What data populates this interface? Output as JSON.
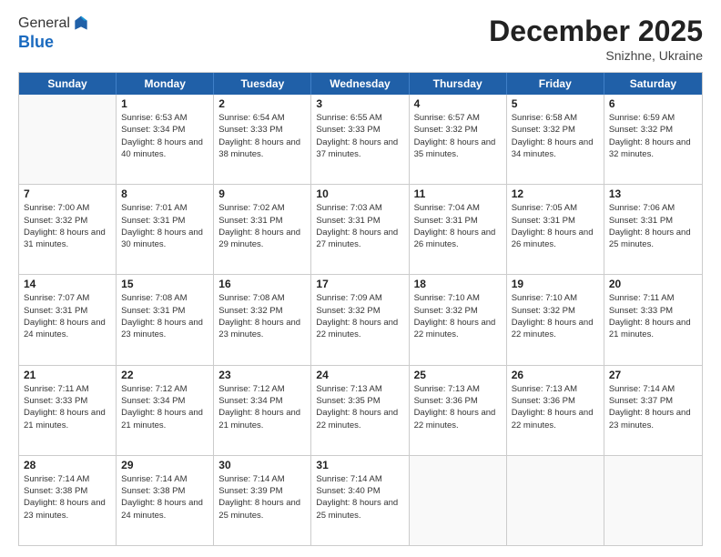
{
  "header": {
    "logo_general": "General",
    "logo_blue": "Blue",
    "month_title": "December 2025",
    "location": "Snizhne, Ukraine"
  },
  "days_of_week": [
    "Sunday",
    "Monday",
    "Tuesday",
    "Wednesday",
    "Thursday",
    "Friday",
    "Saturday"
  ],
  "weeks": [
    [
      {
        "day": "",
        "empty": true
      },
      {
        "day": "1",
        "sunrise": "6:53 AM",
        "sunset": "3:34 PM",
        "daylight": "8 hours and 40 minutes."
      },
      {
        "day": "2",
        "sunrise": "6:54 AM",
        "sunset": "3:33 PM",
        "daylight": "8 hours and 38 minutes."
      },
      {
        "day": "3",
        "sunrise": "6:55 AM",
        "sunset": "3:33 PM",
        "daylight": "8 hours and 37 minutes."
      },
      {
        "day": "4",
        "sunrise": "6:57 AM",
        "sunset": "3:32 PM",
        "daylight": "8 hours and 35 minutes."
      },
      {
        "day": "5",
        "sunrise": "6:58 AM",
        "sunset": "3:32 PM",
        "daylight": "8 hours and 34 minutes."
      },
      {
        "day": "6",
        "sunrise": "6:59 AM",
        "sunset": "3:32 PM",
        "daylight": "8 hours and 32 minutes."
      }
    ],
    [
      {
        "day": "7",
        "sunrise": "7:00 AM",
        "sunset": "3:32 PM",
        "daylight": "8 hours and 31 minutes."
      },
      {
        "day": "8",
        "sunrise": "7:01 AM",
        "sunset": "3:31 PM",
        "daylight": "8 hours and 30 minutes."
      },
      {
        "day": "9",
        "sunrise": "7:02 AM",
        "sunset": "3:31 PM",
        "daylight": "8 hours and 29 minutes."
      },
      {
        "day": "10",
        "sunrise": "7:03 AM",
        "sunset": "3:31 PM",
        "daylight": "8 hours and 27 minutes."
      },
      {
        "day": "11",
        "sunrise": "7:04 AM",
        "sunset": "3:31 PM",
        "daylight": "8 hours and 26 minutes."
      },
      {
        "day": "12",
        "sunrise": "7:05 AM",
        "sunset": "3:31 PM",
        "daylight": "8 hours and 26 minutes."
      },
      {
        "day": "13",
        "sunrise": "7:06 AM",
        "sunset": "3:31 PM",
        "daylight": "8 hours and 25 minutes."
      }
    ],
    [
      {
        "day": "14",
        "sunrise": "7:07 AM",
        "sunset": "3:31 PM",
        "daylight": "8 hours and 24 minutes."
      },
      {
        "day": "15",
        "sunrise": "7:08 AM",
        "sunset": "3:31 PM",
        "daylight": "8 hours and 23 minutes."
      },
      {
        "day": "16",
        "sunrise": "7:08 AM",
        "sunset": "3:32 PM",
        "daylight": "8 hours and 23 minutes."
      },
      {
        "day": "17",
        "sunrise": "7:09 AM",
        "sunset": "3:32 PM",
        "daylight": "8 hours and 22 minutes."
      },
      {
        "day": "18",
        "sunrise": "7:10 AM",
        "sunset": "3:32 PM",
        "daylight": "8 hours and 22 minutes."
      },
      {
        "day": "19",
        "sunrise": "7:10 AM",
        "sunset": "3:32 PM",
        "daylight": "8 hours and 22 minutes."
      },
      {
        "day": "20",
        "sunrise": "7:11 AM",
        "sunset": "3:33 PM",
        "daylight": "8 hours and 21 minutes."
      }
    ],
    [
      {
        "day": "21",
        "sunrise": "7:11 AM",
        "sunset": "3:33 PM",
        "daylight": "8 hours and 21 minutes."
      },
      {
        "day": "22",
        "sunrise": "7:12 AM",
        "sunset": "3:34 PM",
        "daylight": "8 hours and 21 minutes."
      },
      {
        "day": "23",
        "sunrise": "7:12 AM",
        "sunset": "3:34 PM",
        "daylight": "8 hours and 21 minutes."
      },
      {
        "day": "24",
        "sunrise": "7:13 AM",
        "sunset": "3:35 PM",
        "daylight": "8 hours and 22 minutes."
      },
      {
        "day": "25",
        "sunrise": "7:13 AM",
        "sunset": "3:36 PM",
        "daylight": "8 hours and 22 minutes."
      },
      {
        "day": "26",
        "sunrise": "7:13 AM",
        "sunset": "3:36 PM",
        "daylight": "8 hours and 22 minutes."
      },
      {
        "day": "27",
        "sunrise": "7:14 AM",
        "sunset": "3:37 PM",
        "daylight": "8 hours and 23 minutes."
      }
    ],
    [
      {
        "day": "28",
        "sunrise": "7:14 AM",
        "sunset": "3:38 PM",
        "daylight": "8 hours and 23 minutes."
      },
      {
        "day": "29",
        "sunrise": "7:14 AM",
        "sunset": "3:38 PM",
        "daylight": "8 hours and 24 minutes."
      },
      {
        "day": "30",
        "sunrise": "7:14 AM",
        "sunset": "3:39 PM",
        "daylight": "8 hours and 25 minutes."
      },
      {
        "day": "31",
        "sunrise": "7:14 AM",
        "sunset": "3:40 PM",
        "daylight": "8 hours and 25 minutes."
      },
      {
        "day": "",
        "empty": true
      },
      {
        "day": "",
        "empty": true
      },
      {
        "day": "",
        "empty": true
      }
    ]
  ]
}
